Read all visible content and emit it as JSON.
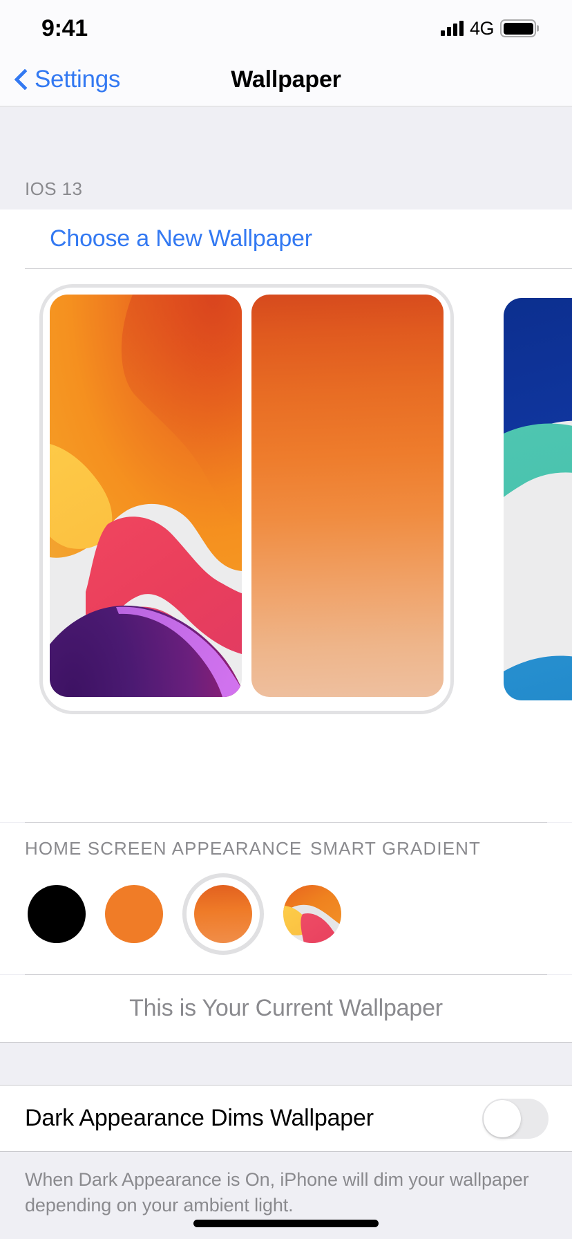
{
  "status_bar": {
    "time": "9:41",
    "network_label": "4G",
    "signal_icon": "signal-bars-icon",
    "battery_icon": "battery-full-icon",
    "signal_bars": 4,
    "battery_level_pct": 100
  },
  "nav_bar": {
    "back_label": "Settings",
    "back_icon": "chevron-left-icon",
    "title": "Wallpaper"
  },
  "sections": {
    "ios13": {
      "header": "IOS 13",
      "choose_new_wallpaper": "Choose a New Wallpaper"
    }
  },
  "preview": {
    "wallpapers": [
      {
        "name": "ios13-abstract-light",
        "kind": "abstract",
        "colors": [
          "#ececed",
          "#f5901f",
          "#d9441f",
          "#ffd34e",
          "#f1475f",
          "#c72064",
          "#3d1263",
          "#c66eee"
        ]
      },
      {
        "name": "ios13-smart-gradient-orange",
        "kind": "gradient",
        "colors": [
          "#d64a1e",
          "#ee7c2c",
          "#eec0a0"
        ]
      },
      {
        "name": "ios13-abstract-blue",
        "kind": "abstract",
        "colors": [
          "#0c2f8f",
          "#1a53c4",
          "#55c9b4",
          "#ececed",
          "#3fa9e8"
        ]
      }
    ]
  },
  "appearance": {
    "home_screen_label": "HOME SCREEN APPEARANCE",
    "smart_gradient_label": "SMART GRADIENT",
    "swatches": [
      {
        "name": "swatch-black",
        "color": "#000000",
        "selected": false
      },
      {
        "name": "swatch-solid-orange",
        "color": "#f07c27",
        "selected": false
      },
      {
        "name": "swatch-gradient-orange",
        "color": "#ef7b28",
        "selected": true
      },
      {
        "name": "swatch-wallpaper-thumbnail",
        "color": "#e8641f",
        "selected": false
      }
    ]
  },
  "current": {
    "label": "This is Your Current Wallpaper"
  },
  "dark_appearance": {
    "label": "Dark Appearance Dims Wallpaper",
    "toggle_state": "off",
    "footer": "When Dark Appearance is On, iPhone will dim your wallpaper depending on your ambient light."
  },
  "colors": {
    "accent_blue": "#3379f2",
    "group_background": "#efeff4",
    "cell_background": "#ffffff",
    "secondary_text": "#8a8a8e",
    "separator": "#d2d2d6"
  },
  "home_indicator": {
    "name": "home-indicator"
  }
}
